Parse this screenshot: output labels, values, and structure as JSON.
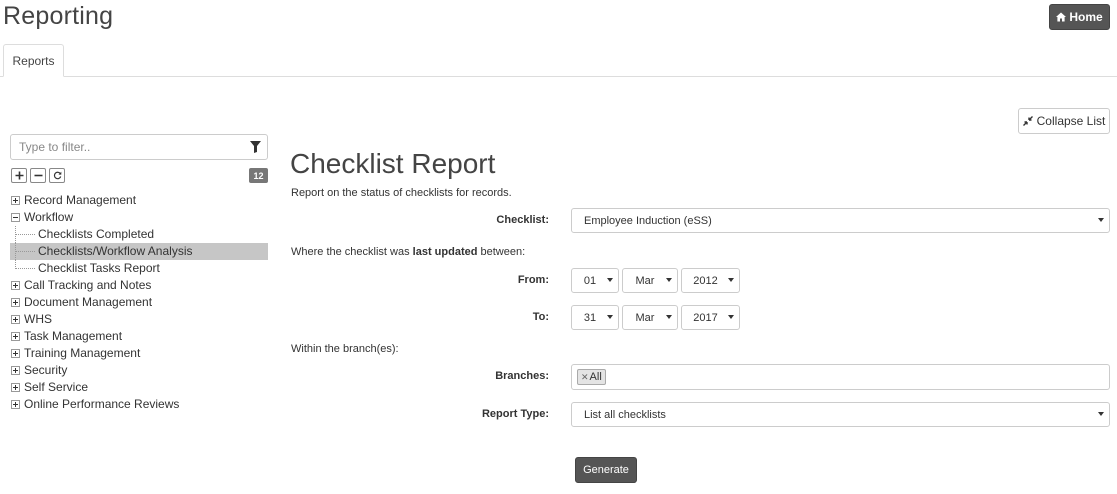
{
  "header": {
    "title": "Reporting",
    "home_label": "Home"
  },
  "tabs": [
    {
      "label": "Reports",
      "active": true
    }
  ],
  "toolbar": {
    "collapse_label": "Collapse List"
  },
  "sidebar": {
    "filter_placeholder": "Type to filter..",
    "count": "12",
    "tree": [
      {
        "label": "Record Management",
        "expanded": false
      },
      {
        "label": "Workflow",
        "expanded": true,
        "children": [
          {
            "label": "Checklists Completed",
            "selected": false
          },
          {
            "label": "Checklists/Workflow Analysis",
            "selected": true
          },
          {
            "label": "Checklist Tasks Report",
            "selected": false
          }
        ]
      },
      {
        "label": "Call Tracking and Notes",
        "expanded": false
      },
      {
        "label": "Document Management",
        "expanded": false
      },
      {
        "label": "WHS",
        "expanded": false
      },
      {
        "label": "Task Management",
        "expanded": false
      },
      {
        "label": "Training Management",
        "expanded": false
      },
      {
        "label": "Security",
        "expanded": false
      },
      {
        "label": "Self Service",
        "expanded": false
      },
      {
        "label": "Online Performance Reviews",
        "expanded": false
      }
    ]
  },
  "report": {
    "title": "Checklist Report",
    "description": "Report on the status of checklists for records.",
    "checklist_label": "Checklist:",
    "checklist_value": "Employee Induction (eSS)",
    "updated_prefix": "Where the checklist was ",
    "updated_bold": "last updated",
    "updated_suffix": " between:",
    "from_label": "From:",
    "from": {
      "day": "01",
      "month": "Mar",
      "year": "2012"
    },
    "to_label": "To:",
    "to": {
      "day": "31",
      "month": "Mar",
      "year": "2017"
    },
    "branch_text": "Within the branch(es):",
    "branches_label": "Branches:",
    "branches": [
      "All"
    ],
    "report_type_label": "Report Type:",
    "report_type_value": "List all checklists",
    "generate_label": "Generate"
  }
}
